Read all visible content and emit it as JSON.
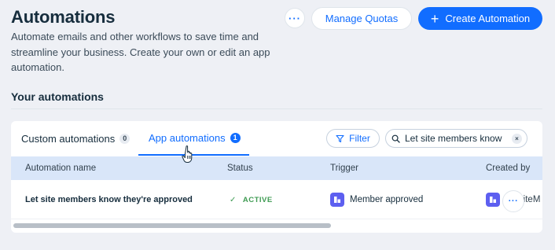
{
  "header": {
    "title": "Automations",
    "description": "Automate emails and other workflows to save time and streamline your business. Create your own or edit an app automation.",
    "more_label": "···",
    "manage_quotas_label": "Manage Quotas",
    "create_label": "Create Automation",
    "create_icon": "+"
  },
  "section": {
    "title": "Your automations"
  },
  "tabs": [
    {
      "label": "Custom automations",
      "count": "0",
      "selected": false
    },
    {
      "label": "App automations",
      "count": "1",
      "selected": true
    }
  ],
  "toolbar": {
    "filter_label": "Filter",
    "search_value": "Let site members know",
    "clear_label": "×"
  },
  "table": {
    "columns": [
      "Automation name",
      "Status",
      "Trigger",
      "Created by"
    ],
    "rows": [
      {
        "name": "Let site members know they're approved",
        "status": "ACTIVE",
        "status_icon": "✓",
        "trigger": "Member approved",
        "created_by": "SiteM",
        "more_label": "···"
      }
    ]
  },
  "colors": {
    "accent": "#116dff",
    "active": "#3f9b53",
    "app_icon": "#5d5ff0"
  }
}
